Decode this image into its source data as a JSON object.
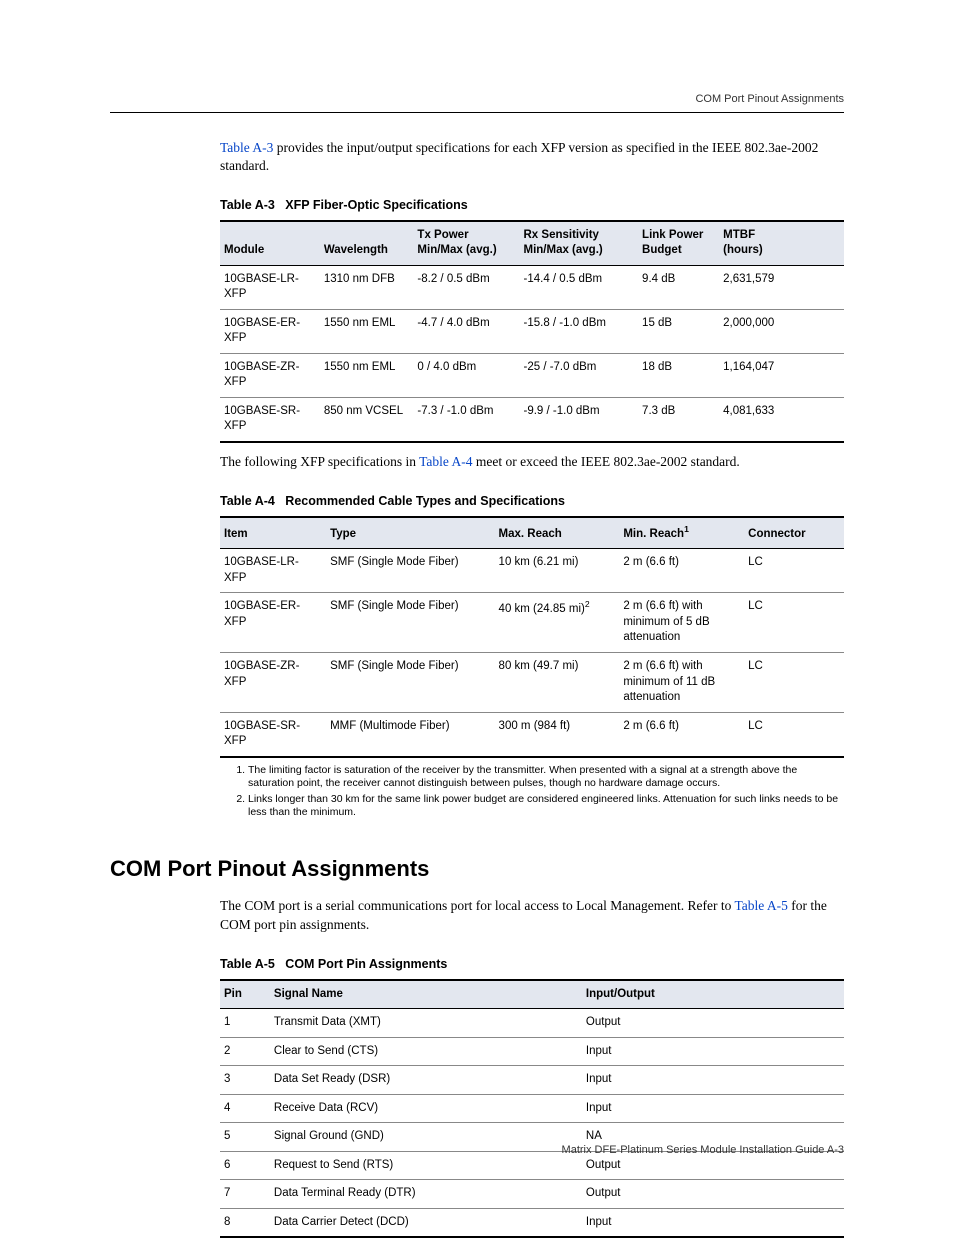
{
  "running_head": "COM Port Pinout Assignments",
  "intro_a3": {
    "link": "Table A-3",
    "rest": " provides the input/output specifications for each XFP version as specified in the IEEE 802.3ae-2002 standard."
  },
  "table_a3": {
    "caption_prefix": "Table A-3",
    "caption_title": "XFP Fiber-Optic Specifications",
    "headers": {
      "module": "Module",
      "wavelength": "Wavelength",
      "tx_l1": "Tx Power",
      "tx_l2": "Min/Max (avg.)",
      "rx_l1": "Rx Sensitivity",
      "rx_l2": "Min/Max (avg.)",
      "lp_l1": "Link Power",
      "lp_l2": "Budget",
      "mtbf_l1": "MTBF",
      "mtbf_l2": "(hours)"
    },
    "rows": [
      {
        "module": "10GBASE-LR-XFP",
        "wl": "1310 nm DFB",
        "tx": "-8.2 / 0.5 dBm",
        "rx": "-14.4 / 0.5 dBm",
        "lp": "9.4 dB",
        "mtbf": "2,631,579"
      },
      {
        "module": "10GBASE-ER-XFP",
        "wl": "1550 nm EML",
        "tx": "-4.7 / 4.0 dBm",
        "rx": "-15.8 / -1.0 dBm",
        "lp": "15 dB",
        "mtbf": "2,000,000"
      },
      {
        "module": "10GBASE-ZR-XFP",
        "wl": "1550 nm EML",
        "tx": "0 / 4.0 dBm",
        "rx": "-25 / -7.0 dBm",
        "lp": "18 dB",
        "mtbf": "1,164,047"
      },
      {
        "module": "10GBASE-SR-XFP",
        "wl": "850 nm VCSEL",
        "tx": "-7.3 / -1.0 dBm",
        "rx": "-9.9 / -1.0 dBm",
        "lp": "7.3 dB",
        "mtbf": "4,081,633"
      }
    ]
  },
  "intro_a4": {
    "before": "The following XFP specifications in ",
    "link": "Table A-4",
    "after": " meet or exceed the IEEE 802.3ae-2002 standard."
  },
  "table_a4": {
    "caption_prefix": "Table A-4",
    "caption_title": "Recommended Cable Types and Specifications",
    "headers": {
      "item": "Item",
      "type": "Type",
      "max": "Max. Reach",
      "min": "Min. Reach",
      "conn": "Connector"
    },
    "rows": [
      {
        "item": "10GBASE-LR-XFP",
        "type": "SMF (Single Mode Fiber)",
        "max": "10 km (6.21 mi)",
        "min": "2 m (6.6 ft)",
        "conn": "LC",
        "max_sup": "",
        "min_extra": ""
      },
      {
        "item": "10GBASE-ER-XFP",
        "type": "SMF (Single Mode Fiber)",
        "max": "40 km (24.85 mi)",
        "min": "2 m (6.6 ft) with minimum of 5 dB attenuation",
        "conn": "LC",
        "max_sup": "2",
        "min_extra": ""
      },
      {
        "item": "10GBASE-ZR-XFP",
        "type": "SMF (Single Mode Fiber)",
        "max": "80 km (49.7 mi)",
        "min": "2 m (6.6 ft) with minimum of 11 dB attenuation",
        "conn": "LC",
        "max_sup": "",
        "min_extra": ""
      },
      {
        "item": "10GBASE-SR-XFP",
        "type": "MMF (Multimode Fiber)",
        "max": "300 m (984 ft)",
        "min": "2 m (6.6 ft)",
        "conn": "LC",
        "max_sup": "",
        "min_extra": ""
      }
    ],
    "footnotes": [
      "The limiting factor is saturation of the receiver by the transmitter. When presented with a signal at a strength above the saturation point, the receiver cannot distinguish between pulses, though no hardware damage occurs.",
      "Links longer than 30 km for the same link power budget are considered engineered links. Attenuation for such links needs to be less than the minimum."
    ]
  },
  "section_heading": "COM Port Pinout Assignments",
  "intro_a5": {
    "line1": "The COM port is a serial communications port for local access to Local Management. Refer to ",
    "link": "Table A-5",
    "after": " for the COM port pin assignments."
  },
  "table_a5": {
    "caption_prefix": "Table A-5",
    "caption_title": "COM Port Pin Assignments",
    "headers": {
      "pin": "Pin",
      "sig": "Signal Name",
      "io": "Input/Output"
    },
    "rows": [
      {
        "pin": "1",
        "sig": "Transmit Data (XMT)",
        "io": "Output"
      },
      {
        "pin": "2",
        "sig": "Clear to Send (CTS)",
        "io": "Input"
      },
      {
        "pin": "3",
        "sig": "Data Set Ready (DSR)",
        "io": "Input"
      },
      {
        "pin": "4",
        "sig": "Receive Data (RCV)",
        "io": "Input"
      },
      {
        "pin": "5",
        "sig": "Signal Ground (GND)",
        "io": "NA"
      },
      {
        "pin": "6",
        "sig": "Request to Send (RTS)",
        "io": "Output"
      },
      {
        "pin": "7",
        "sig": "Data Terminal Ready (DTR)",
        "io": "Output"
      },
      {
        "pin": "8",
        "sig": "Data Carrier Detect (DCD)",
        "io": "Input"
      }
    ]
  },
  "footer": "Matrix DFE-Platinum Series Module Installation Guide    A-3"
}
